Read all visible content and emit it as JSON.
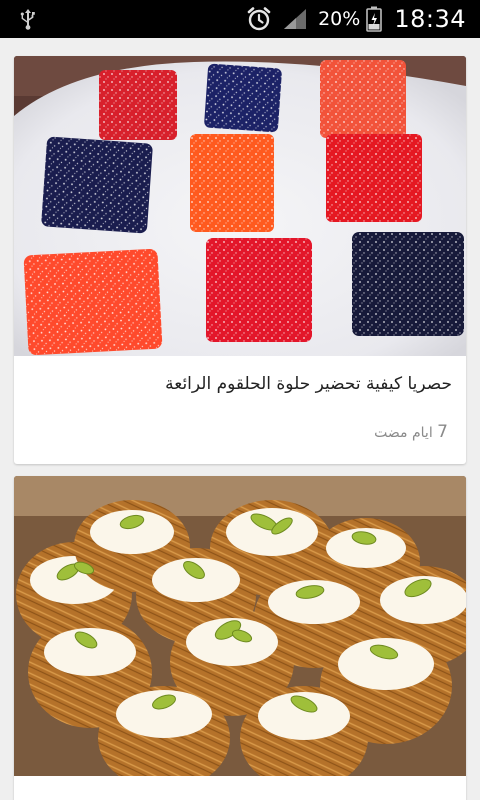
{
  "status_bar": {
    "battery_percent": "20%",
    "time": "18:34",
    "icons": [
      "usb-icon",
      "alarm-icon",
      "signal-icon",
      "battery-icon"
    ]
  },
  "feed": {
    "items": [
      {
        "image": "jelly-candy-photo",
        "title": "حصريا كيفية تحضير حلوة الحلقوم الرائعة",
        "age_number": "7",
        "age_label": "ايام مضت"
      },
      {
        "image": "kunafa-nests-photo",
        "title": "",
        "age_number": "",
        "age_label": ""
      }
    ]
  }
}
